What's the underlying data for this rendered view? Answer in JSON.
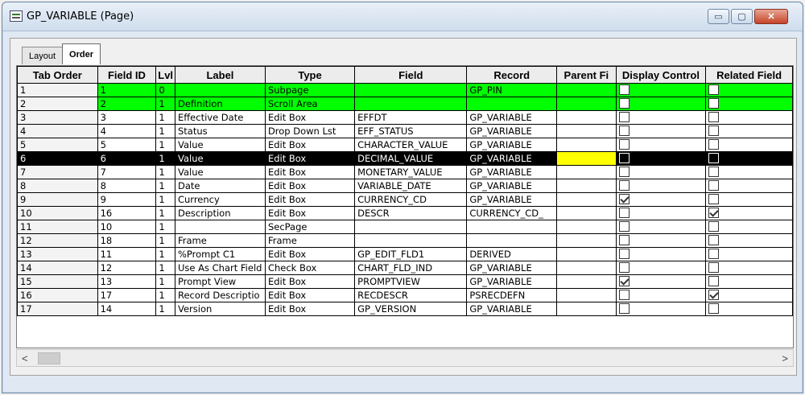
{
  "window": {
    "title": "GP_VARIABLE (Page)",
    "controls": {
      "minimize": "▭",
      "maximize": "▢",
      "close": "✕"
    }
  },
  "tabs": [
    {
      "label": "Layout",
      "active": false
    },
    {
      "label": "Order",
      "active": true
    }
  ],
  "grid": {
    "columns": [
      "Tab Order",
      "Field ID",
      "Lvl",
      "Label",
      "Type",
      "Field",
      "Record",
      "Parent Fi",
      "Display Control",
      "Related Field"
    ],
    "rows": [
      {
        "tab": "1",
        "fid": "1",
        "lvl": "0",
        "label": "",
        "type": "Subpage",
        "field": "",
        "record": "GP_PIN",
        "disp": false,
        "rel": false,
        "style": "green"
      },
      {
        "tab": "2",
        "fid": "2",
        "lvl": "1",
        "label": "Definition",
        "type": "Scroll Area",
        "field": "",
        "record": "",
        "disp": false,
        "rel": false,
        "style": "green"
      },
      {
        "tab": "3",
        "fid": "3",
        "lvl": "1",
        "label": "Effective Date",
        "type": "Edit Box",
        "field": "EFFDT",
        "record": "GP_VARIABLE",
        "disp": false,
        "rel": false,
        "style": ""
      },
      {
        "tab": "4",
        "fid": "4",
        "lvl": "1",
        "label": "Status",
        "type": "Drop Down Lst",
        "field": "EFF_STATUS",
        "record": "GP_VARIABLE",
        "disp": false,
        "rel": false,
        "style": ""
      },
      {
        "tab": "5",
        "fid": "5",
        "lvl": "1",
        "label": "Value",
        "type": "Edit Box",
        "field": "CHARACTER_VALUE",
        "record": "GP_VARIABLE",
        "disp": false,
        "rel": false,
        "style": ""
      },
      {
        "tab": "6",
        "fid": "6",
        "lvl": "1",
        "label": "Value",
        "type": "Edit Box",
        "field": "DECIMAL_VALUE",
        "record": "GP_VARIABLE",
        "disp": false,
        "rel": false,
        "style": "sel"
      },
      {
        "tab": "7",
        "fid": "7",
        "lvl": "1",
        "label": "Value",
        "type": "Edit Box",
        "field": "MONETARY_VALUE",
        "record": "GP_VARIABLE",
        "disp": false,
        "rel": false,
        "style": ""
      },
      {
        "tab": "8",
        "fid": "8",
        "lvl": "1",
        "label": "Date",
        "type": "Edit Box",
        "field": "VARIABLE_DATE",
        "record": "GP_VARIABLE",
        "disp": false,
        "rel": false,
        "style": ""
      },
      {
        "tab": "9",
        "fid": "9",
        "lvl": "1",
        "label": "Currency",
        "type": "Edit Box",
        "field": "CURRENCY_CD",
        "record": "GP_VARIABLE",
        "disp": true,
        "rel": false,
        "style": ""
      },
      {
        "tab": "10",
        "fid": "16",
        "lvl": "1",
        "label": "Description",
        "type": "Edit Box",
        "field": "DESCR",
        "record": "CURRENCY_CD_",
        "disp": false,
        "rel": true,
        "style": ""
      },
      {
        "tab": "11",
        "fid": "10",
        "lvl": "1",
        "label": "",
        "type": "SecPage",
        "field": "",
        "record": "",
        "disp": false,
        "rel": false,
        "style": ""
      },
      {
        "tab": "12",
        "fid": "18",
        "lvl": "1",
        "label": "Frame",
        "type": "Frame",
        "field": "",
        "record": "",
        "disp": false,
        "rel": false,
        "style": ""
      },
      {
        "tab": "13",
        "fid": "11",
        "lvl": "1",
        "label": "%Prompt C1",
        "type": "Edit Box",
        "field": "GP_EDIT_FLD1",
        "record": "DERIVED",
        "disp": false,
        "rel": false,
        "style": ""
      },
      {
        "tab": "14",
        "fid": "12",
        "lvl": "1",
        "label": "Use As Chart Field",
        "type": "Check Box",
        "field": "CHART_FLD_IND",
        "record": "GP_VARIABLE",
        "disp": false,
        "rel": false,
        "style": ""
      },
      {
        "tab": "15",
        "fid": "13",
        "lvl": "1",
        "label": "Prompt View",
        "type": "Edit Box",
        "field": "PROMPTVIEW",
        "record": "GP_VARIABLE",
        "disp": true,
        "rel": false,
        "style": ""
      },
      {
        "tab": "16",
        "fid": "17",
        "lvl": "1",
        "label": "Record Descriptio",
        "type": "Edit Box",
        "field": "RECDESCR",
        "record": "PSRECDEFN",
        "disp": false,
        "rel": true,
        "style": ""
      },
      {
        "tab": "17",
        "fid": "14",
        "lvl": "1",
        "label": "Version",
        "type": "Edit Box",
        "field": "GP_VERSION",
        "record": "GP_VARIABLE",
        "disp": false,
        "rel": false,
        "style": ""
      }
    ]
  },
  "scrollbar": {
    "left_arrow": "<",
    "right_arrow": ">"
  }
}
